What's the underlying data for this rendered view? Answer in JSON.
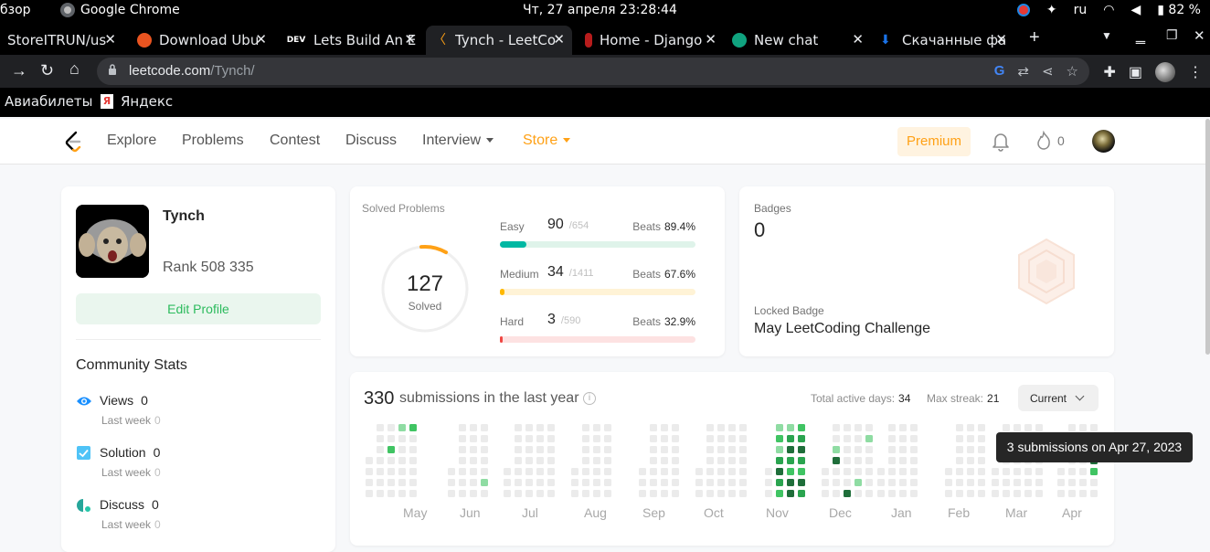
{
  "os": {
    "left_label": "бзор",
    "app_name": "Google Chrome",
    "clock": "Чт, 27 апреля  23:28:44",
    "lang": "ru",
    "battery": "82 %"
  },
  "tabs": [
    {
      "label": "StoreITRUN/us",
      "color": "#ffffff"
    },
    {
      "label": "Download Ubu",
      "color": "#e95420"
    },
    {
      "label": "Lets Build An E",
      "color": "#ffffff"
    },
    {
      "label": "Tynch - LeetCo",
      "color": "#ffa116"
    },
    {
      "label": "Home - Django",
      "color": "#c62828"
    },
    {
      "label": "New chat",
      "color": "#10a37f"
    },
    {
      "label": "Скачанные фа",
      "color": "#1a73e8"
    }
  ],
  "tab_icons": {
    "dev_label": "DEV",
    "new_tab": "+"
  },
  "omnibox": {
    "host": "leetcode.com",
    "path": "/Tynch/"
  },
  "bookmarks": [
    {
      "label": "Авиабилеты"
    },
    {
      "label": "Яндекс",
      "icon_text": "Я"
    }
  ],
  "lcnav": {
    "links": [
      "Explore",
      "Problems",
      "Contest",
      "Discuss",
      "Interview",
      "Store"
    ],
    "premium": "Premium",
    "streak": "0"
  },
  "profile": {
    "name": "Tynch",
    "rank": "Rank 508 335",
    "edit_label": "Edit Profile",
    "community_title": "Community Stats",
    "stats": [
      {
        "label": "Views",
        "value": "0",
        "sub": "Last week",
        "sub_value": "0",
        "color": "#1a90ff"
      },
      {
        "label": "Solution",
        "value": "0",
        "sub": "Last week",
        "sub_value": "0",
        "color": "#4fc3f7"
      },
      {
        "label": "Discuss",
        "value": "0",
        "sub": "Last week",
        "sub_value": "0",
        "color": "#26a69a"
      }
    ]
  },
  "solved": {
    "title": "Solved Problems",
    "total": "127",
    "total_label": "Solved",
    "difficulties": [
      {
        "name": "Easy",
        "solved": "90",
        "total": "/654",
        "beats_label": "Beats",
        "beats": "89.4%",
        "fraction": 0.1376,
        "color": "#00b8a3",
        "track": "#dff3ea"
      },
      {
        "name": "Medium",
        "solved": "34",
        "total": "/1411",
        "beats_label": "Beats",
        "beats": "67.6%",
        "fraction": 0.0241,
        "color": "#ffb800",
        "track": "#fff3d6"
      },
      {
        "name": "Hard",
        "solved": "3",
        "total": "/590",
        "beats_label": "Beats",
        "beats": "32.9%",
        "fraction": 0.0051,
        "color": "#ef4743",
        "track": "#fde2e2"
      }
    ]
  },
  "badges": {
    "title": "Badges",
    "count": "0",
    "locked_label": "Locked Badge",
    "locked_name": "May LeetCoding Challenge"
  },
  "submissions": {
    "count": "330",
    "text": "submissions in the last year",
    "active_label": "Total active days:",
    "active_value": "34",
    "streak_label": "Max streak:",
    "streak_value": "21",
    "period": "Current",
    "months": [
      "May",
      "Jun",
      "Jul",
      "Aug",
      "Sep",
      "Oct",
      "Nov",
      "Dec",
      "Jan",
      "Feb",
      "Mar",
      "Apr"
    ],
    "colors": {
      "empty": "#ebebeb",
      "l1": "#8fdca3",
      "l2": "#40c463",
      "l3": "#2aa44f",
      "l4": "#1f6e3a"
    },
    "tooltip": "3 submissions on Apr 27, 2023"
  }
}
